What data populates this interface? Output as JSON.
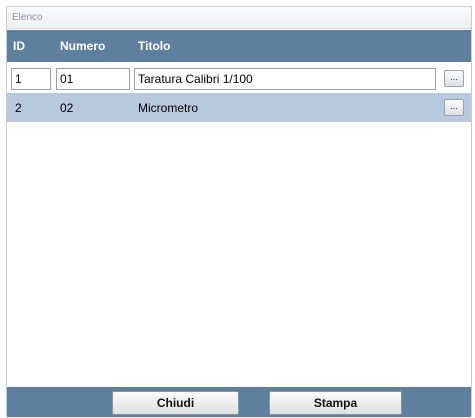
{
  "window": {
    "title": "Elenco"
  },
  "table": {
    "headers": [
      "ID",
      "Numero",
      "Titolo"
    ],
    "rows": [
      {
        "id": "1",
        "numero": "01",
        "titolo": "Taratura Calibri 1/100",
        "action": "..."
      },
      {
        "id": "2",
        "numero": "02",
        "titolo": "Micrometro",
        "action": "..."
      }
    ]
  },
  "footer": {
    "close_label": "Chiudi",
    "print_label": "Stampa"
  },
  "colors": {
    "header": "#5f7f9e",
    "selected_row": "#b8c9de"
  }
}
